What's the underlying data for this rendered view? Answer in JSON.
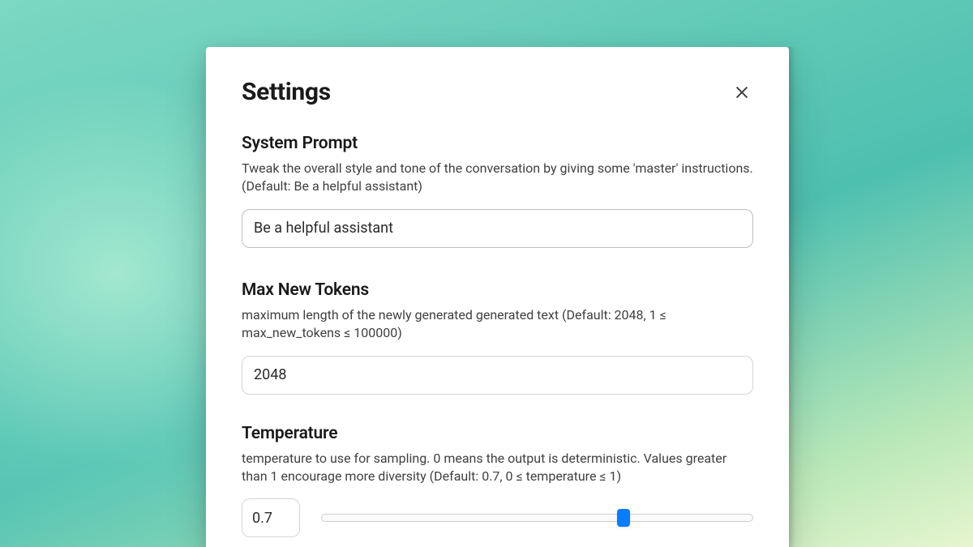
{
  "header": {
    "title": "Settings"
  },
  "sections": {
    "system_prompt": {
      "title": "System Prompt",
      "description": "Tweak the overall style and tone of the conversation by giving some 'master' instructions. (Default: Be a helpful assistant)",
      "value": "Be a helpful assistant"
    },
    "max_new_tokens": {
      "title": "Max New Tokens",
      "description": "maximum length of the newly generated generated text (Default: 2048, 1 ≤ max_new_tokens ≤ 100000)",
      "value": "2048"
    },
    "temperature": {
      "title": "Temperature",
      "description": "temperature to use for sampling. 0 means the output is deterministic. Values greater than 1 encourage more diversity (Default: 0.7, 0 ≤ temperature ≤ 1)",
      "value": "0.7",
      "min": 0,
      "max": 1,
      "current": 0.7
    }
  }
}
